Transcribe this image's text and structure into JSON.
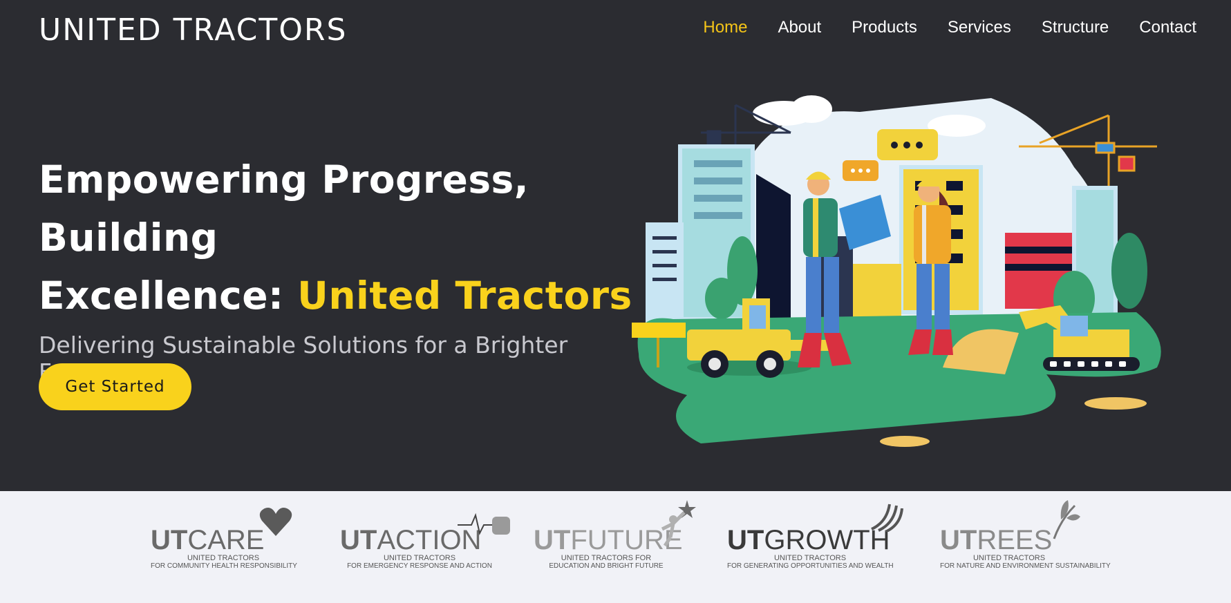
{
  "header": {
    "brand": "UNITED TRACTORS",
    "nav": [
      {
        "label": "Home",
        "active": true
      },
      {
        "label": "About",
        "active": false
      },
      {
        "label": "Products",
        "active": false
      },
      {
        "label": "Services",
        "active": false
      },
      {
        "label": "Structure",
        "active": false
      },
      {
        "label": "Contact",
        "active": false
      }
    ]
  },
  "hero": {
    "title_part1": "Empowering Progress, Building",
    "title_part2": "Excellence: ",
    "title_accent": "United Tractors",
    "subtitle": "Delivering Sustainable Solutions for a Brighter Future",
    "cta_label": "Get Started"
  },
  "colors": {
    "background": "#2b2c31",
    "accent": "#f9d21c",
    "band": "#f1f2f7"
  },
  "partners": [
    {
      "prefix": "UT",
      "name": "CARE",
      "line1": "UNITED TRACTORS",
      "line2": "FOR COMMUNITY HEALTH RESPONSIBILITY",
      "icon": "heart-icon"
    },
    {
      "prefix": "UT",
      "name": "ACTION",
      "line1": "UNITED TRACTORS",
      "line2": "FOR EMERGENCY RESPONSE AND ACTION",
      "icon": "fist-icon"
    },
    {
      "prefix": "UT",
      "name": "FUTURE",
      "line1": "UNITED TRACTORS FOR",
      "line2": "EDUCATION AND BRIGHT FUTURE",
      "icon": "star-person-icon"
    },
    {
      "prefix": "UT",
      "name": "GROWTH",
      "line1": "UNITED TRACTORS",
      "line2": "FOR GENERATING OPPORTUNITIES AND WEALTH",
      "icon": "wave-icon"
    },
    {
      "prefix": "UT",
      "name": "REES",
      "line1": "UNITED TRACTORS",
      "line2": "FOR NATURE AND ENVIRONMENT SUSTAINABILITY",
      "icon": "leaf-icon"
    }
  ]
}
